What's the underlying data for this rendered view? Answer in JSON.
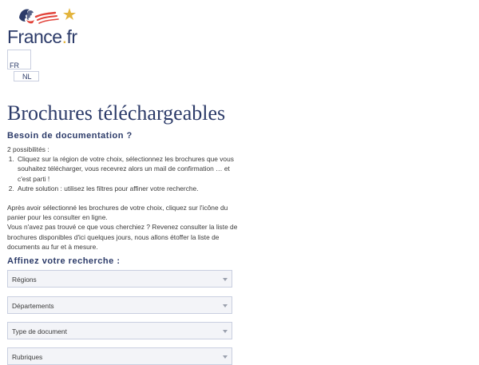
{
  "logo": {
    "text_main": "France",
    "text_dot": ".",
    "text_tld": "fr"
  },
  "lang": {
    "fr": "FR",
    "nl": "NL"
  },
  "page": {
    "title": "Brochures téléchargeables",
    "subtitle": "Besoin de documentation ?",
    "intro": "2 possibilités :",
    "steps": [
      "Cliquez sur la région de votre choix, sélectionnez les brochures que vous souhaitez télécharger, vous recevrez alors un mail de confirmation … et c'est parti !",
      "Autre solution : utilisez les filtres pour affiner votre recherche."
    ],
    "para1": "Après avoir sélectionné les brochures de votre choix, cliquez sur l'icône du panier pour les consulter en ligne.",
    "para2": "Vous n'avez pas trouvé ce que vous cherchiez ? Revenez consulter la liste de brochures disponibles d'ici quelques jours, nous allons étoffer la liste de documents au fur et à mesure."
  },
  "filters": {
    "heading": "Affinez votre recherche :",
    "regions": "Régions",
    "departements": "Départements",
    "type": "Type de document",
    "rubriques": "Rubriques"
  },
  "colors": {
    "brand_navy": "#2c3b69",
    "accent_red": "#e2433a",
    "accent_gold": "#e3b43c"
  }
}
